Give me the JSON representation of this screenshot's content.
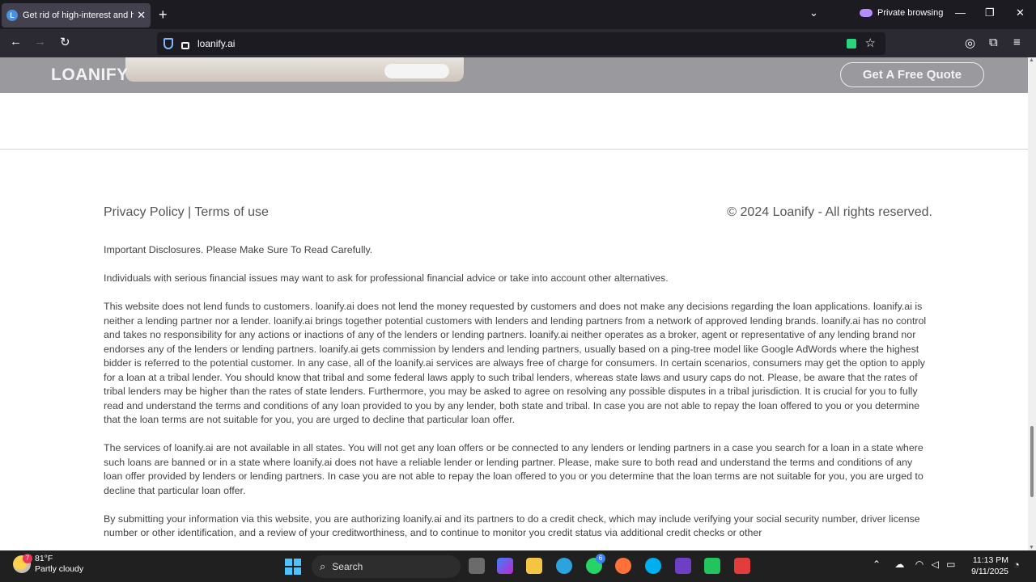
{
  "browser": {
    "tab_title": "Get rid of high-interest and high",
    "tab_favicon_letter": "L",
    "private_label": "Private browsing",
    "url": "loanify.ai"
  },
  "site": {
    "logo": "LOANIFY",
    "cta_button": "Get A Free Quote",
    "footer": {
      "privacy_link": "Privacy Policy",
      "separator": "|",
      "terms_link": "Terms of use",
      "copyright": "© 2024 Loanify - All rights reserved."
    },
    "disclosures": [
      "Important Disclosures. Please Make Sure To Read Carefully.",
      "Individuals with serious financial issues may want to ask for professional financial advice or take into account other alternatives.",
      "This website does not lend funds to customers. loanify.ai does not lend the money requested by customers and does not make any decisions regarding the loan applications. loanify.ai is neither a lending partner nor a lender. loanify.ai brings together potential customers with lenders and lending partners from a network of approved lending brands. loanify.ai has no control and takes no responsibility for any actions or inactions of any of the lenders or lending partners. loanify.ai neither operates as a broker, agent or representative of any lending brand nor endorses any of the lenders or lending partners. loanify.ai gets commission by lenders and lending partners, usually based on a ping-tree model like Google AdWords where the highest bidder is referred to the potential customer. In any case, all of the loanify.ai services are always free of charge for consumers. In certain scenarios, consumers may get the option to apply for a loan at a tribal lender. You should know that tribal and some federal laws apply to such tribal lenders, whereas state laws and usury caps do not. Please, be aware that the rates of tribal lenders may be higher than the rates of state lenders. Furthermore, you may be asked to agree on resolving any possible disputes in a tribal jurisdiction. It is crucial for you to fully read and understand the terms and conditions of any loan provided to you by any lender, both state and tribal. In case you are not able to repay the loan offered to you or you determine that the loan terms are not suitable for you, you are urged to decline that particular loan offer.",
      "The services of loanify.ai are not available in all states. You will not get any loan offers or be connected to any lenders or lending partners in a case you search for a loan in a state where such loans are banned or in a state where loanify.ai does not have a reliable lender or lending partner. Please, make sure to both read and understand the terms and conditions of any loan offer provided by lenders or lending partners. In case you are not able to repay the loan offered to you or you determine that the loan terms are not suitable for you, you are urged to decline that particular loan offer.",
      "By submitting your information via this website, you are authorizing loanify.ai and its partners to do a credit check, which may include verifying your social security number, driver license number or other identification, and a review of your creditworthiness, and to continue to monitor you credit status via additional credit checks or other"
    ]
  },
  "taskbar": {
    "weather_temp": "81°F",
    "weather_desc": "Partly cloudy",
    "weather_badge": "7",
    "search_label": "Search",
    "whatsapp_badge": "6",
    "time": "11:13 PM",
    "date": "9/11/2025"
  },
  "colors": {
    "header_overlay": "#9a999e",
    "page_bg": "#ffffff",
    "browser_dark": "#1c1b22",
    "taskbar": "#202020"
  }
}
